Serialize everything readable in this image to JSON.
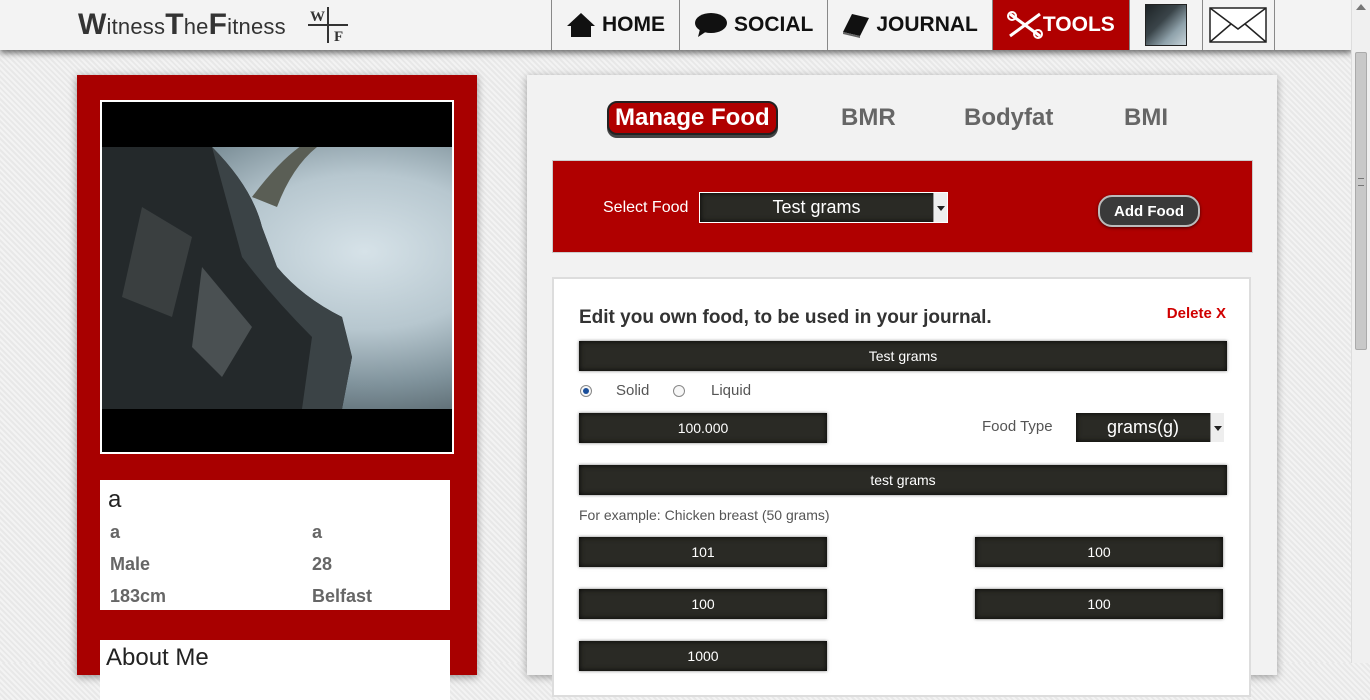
{
  "header": {
    "logo_text": "WitnessTheFitness",
    "logo_mark": [
      "W",
      "F"
    ],
    "nav": [
      {
        "label": "HOME",
        "icon": "home-icon"
      },
      {
        "label": "SOCIAL",
        "icon": "speech-bubble-icon"
      },
      {
        "label": "JOURNAL",
        "icon": "book-icon"
      },
      {
        "label": "TOOLS",
        "icon": "tools-icon",
        "active": true
      }
    ],
    "avatar_icon": "avatar",
    "mail_icon": "envelope-icon"
  },
  "profile": {
    "name": "a",
    "first": "a",
    "last": "a",
    "gender": "Male",
    "age": "28",
    "height": "183cm",
    "location": "Belfast",
    "about_heading": "About Me"
  },
  "tools": {
    "tabs": [
      "Manage Food",
      "BMR",
      "Bodyfat",
      "BMI"
    ],
    "select_label": "Select Food",
    "selected_food": "Test grams",
    "add_food_label": "Add Food",
    "edit_title": "Edit you own food, to be used in your journal.",
    "delete_label": "Delete X",
    "food_name": "Test grams",
    "solid_label": "Solid",
    "liquid_label": "Liquid",
    "quantity": "100.000",
    "food_type_label": "Food Type",
    "food_type_value": "grams(g)",
    "description": "test grams",
    "example_text": "For example: Chicken breast (50 grams)",
    "nutrient_values": [
      "101",
      "100",
      "100",
      "100",
      "1000"
    ]
  },
  "colors": {
    "accent": "#b00000",
    "field_dark": "#2a2a25",
    "delete_red": "#d00000"
  }
}
